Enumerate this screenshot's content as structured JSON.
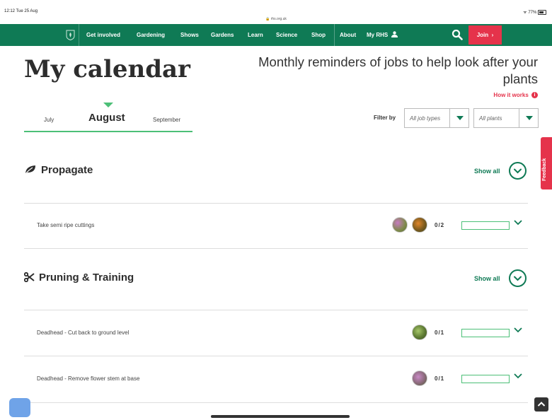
{
  "status_bar": {
    "time": "12:12  Tue 25 Aug",
    "url": "rhs.org.uk",
    "battery": "77%"
  },
  "nav": {
    "items": [
      "Get involved",
      "Gardening",
      "Shows",
      "Gardens",
      "Learn",
      "Science",
      "Shop",
      "About",
      "My RHS"
    ],
    "join": "Join"
  },
  "header": {
    "title": "My calendar",
    "tagline": "Monthly reminders of jobs to help look after your plants",
    "how_it_works": "How it works"
  },
  "months": {
    "prev": "July",
    "current": "August",
    "next": "September"
  },
  "filters": {
    "label": "Filter by",
    "job_types": "All job types",
    "plants": "All plants"
  },
  "sections": [
    {
      "title": "Propagate",
      "icon": "leaf-icon",
      "show_all": "Show all",
      "tasks": [
        {
          "name": "Take semi ripe cuttings",
          "count": "0/2"
        }
      ]
    },
    {
      "title": "Pruning & Training",
      "icon": "scissors-icon",
      "show_all": "Show all",
      "tasks": [
        {
          "name": "Deadhead - Cut back to ground level",
          "count": "0/1"
        },
        {
          "name": "Deadhead - Remove flower stem at base",
          "count": "0/1"
        }
      ]
    }
  ],
  "feedback": "Feedback",
  "colors": {
    "brand_green": "#0f7a55",
    "accent_green": "#4cbf77",
    "accent_red": "#e5334b"
  }
}
